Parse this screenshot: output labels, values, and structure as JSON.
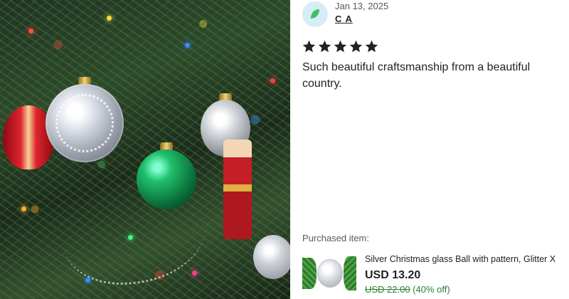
{
  "review": {
    "date": "Jan 13, 2025",
    "reviewer_name": "C A",
    "rating": 5,
    "rating_max": 5,
    "text": "Such beautiful craftsmanship from a beautiful country."
  },
  "purchased": {
    "label": "Purchased item:",
    "title": "Silver Christmas glass Ball with pattern, Glitter X",
    "price": "USD 13.20",
    "original_price": "USD 22.00",
    "discount": "(40% off)"
  },
  "icons": {
    "avatar": "leaf-avatar-icon",
    "star": "star-icon"
  },
  "colors": {
    "star": "#222222",
    "avatar_bg": "#d6ecf6",
    "avatar_leaf": "#3fbf5f",
    "sale_green": "#2f7d32"
  }
}
